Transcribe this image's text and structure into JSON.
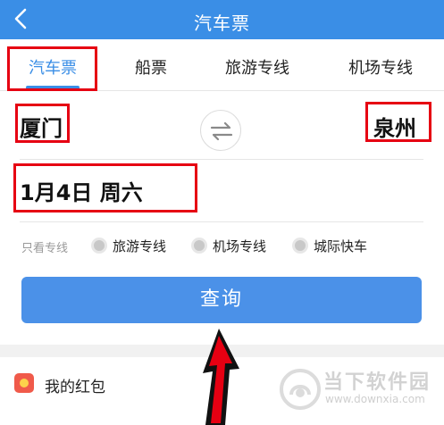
{
  "colors": {
    "primary": "#3a8ee6",
    "button": "#4b91e8",
    "highlight": "#e60012",
    "red": "#f05a4a"
  },
  "header": {
    "title": "汽车票",
    "back_icon": "chevron-left-icon"
  },
  "tabs": [
    {
      "label": "汽车票",
      "active": true
    },
    {
      "label": "船票",
      "active": false
    },
    {
      "label": "旅游专线",
      "active": false
    },
    {
      "label": "机场专线",
      "active": false
    }
  ],
  "route": {
    "from_city": "厦门",
    "to_city": "泉州",
    "swap_icon": "swap-arrows-icon"
  },
  "date": {
    "value": "1月4日 周六"
  },
  "filter": {
    "label": "只看专线",
    "options": [
      {
        "label": "旅游专线",
        "selected": false
      },
      {
        "label": "机场专线",
        "selected": false
      },
      {
        "label": "城际快车",
        "selected": false
      }
    ]
  },
  "query_button": {
    "label": "查询"
  },
  "bottom": {
    "red_packet_label": "我的红包",
    "red_packet_icon": "red-packet-icon"
  },
  "watermark": {
    "title": "当下软件园",
    "url": "www.downxia.com"
  }
}
